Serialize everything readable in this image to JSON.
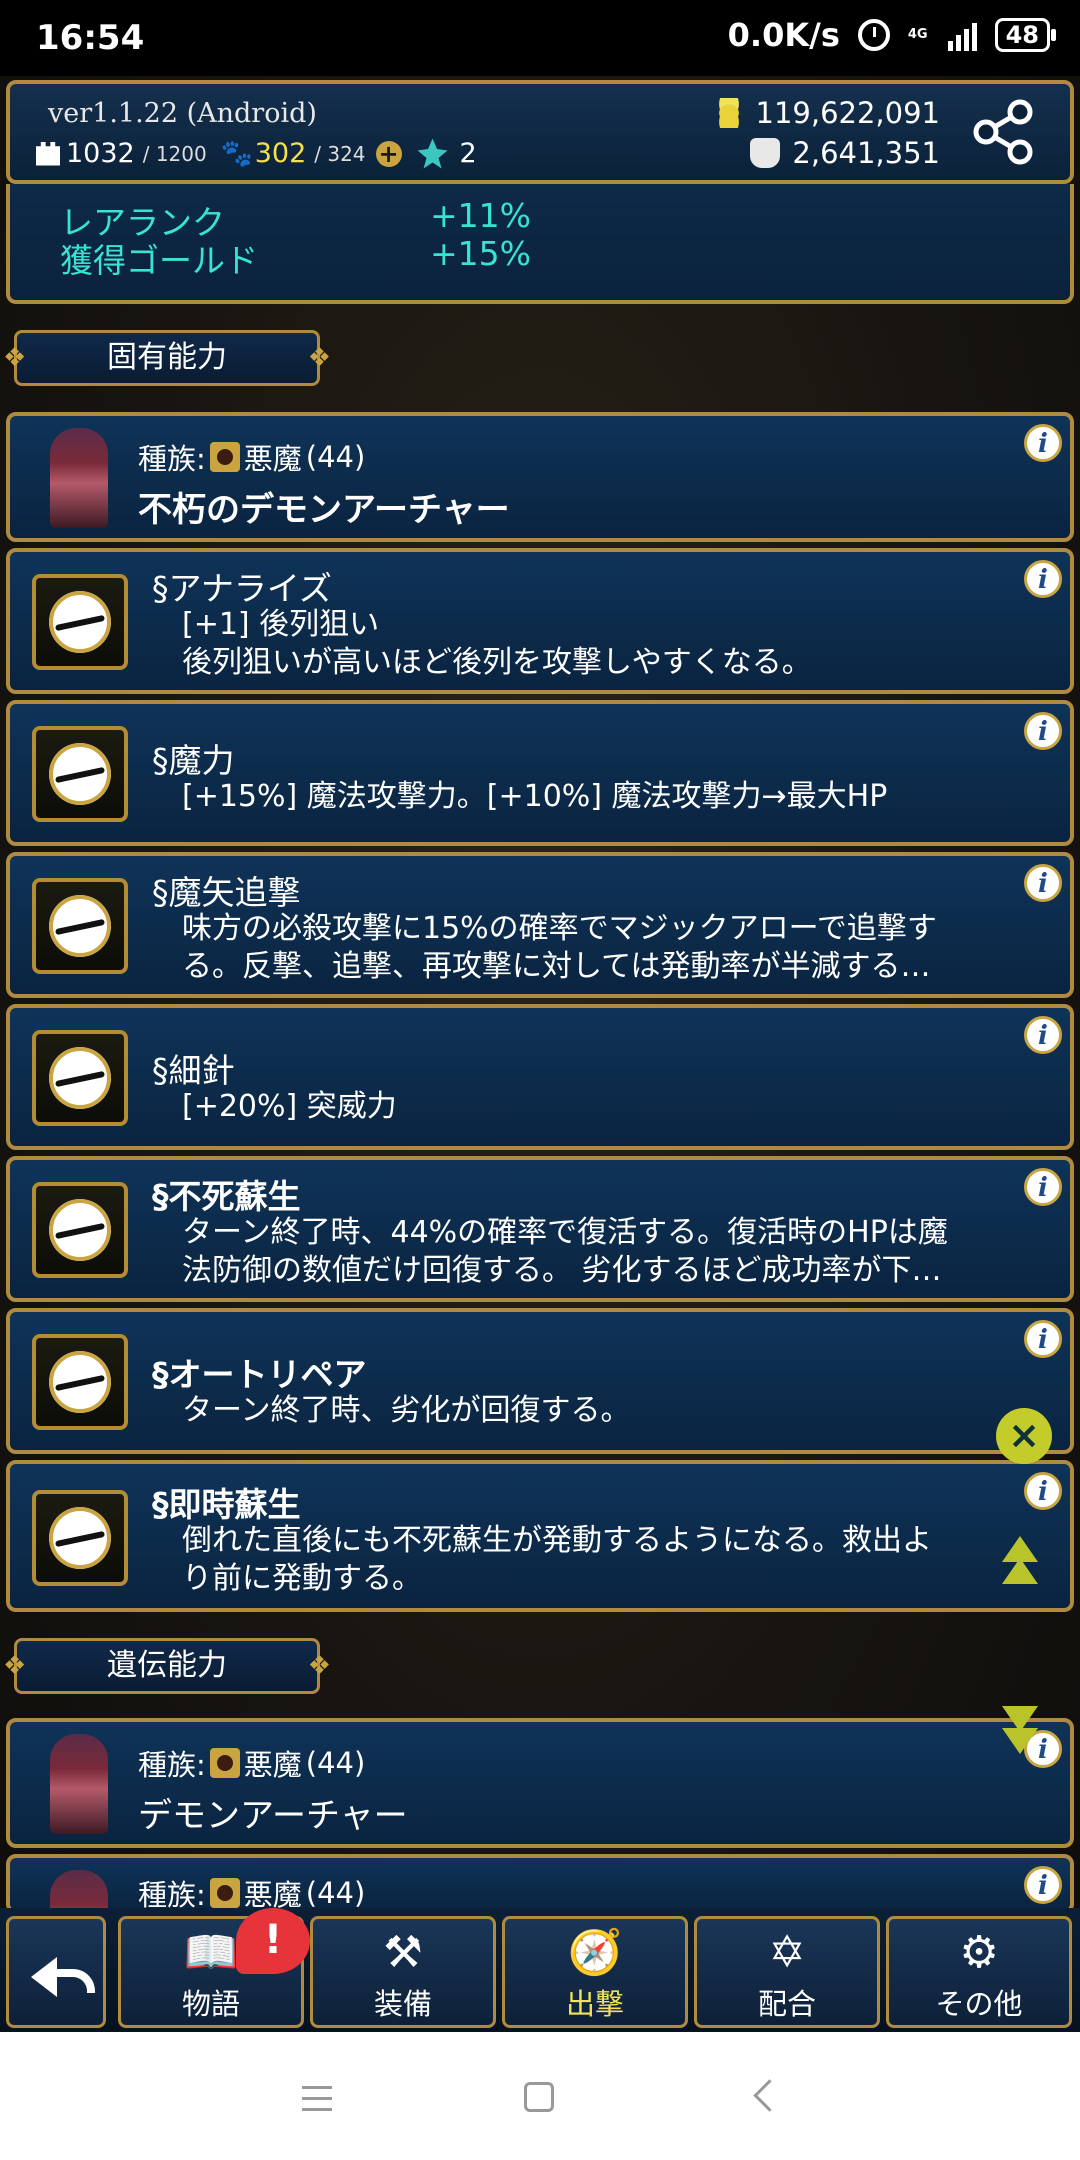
{
  "statusbar": {
    "time": "16:54",
    "network": "0.0K/s",
    "signal_type": "4G",
    "battery": "48"
  },
  "header": {
    "version": "ver1.1.22 (Android)",
    "castle_value": "1032",
    "castle_max": "/ 1200",
    "paw_value": "302",
    "paw_max": "/ 324",
    "crystal_count": "2",
    "gold": "119,622,091",
    "gems": "2,641,351"
  },
  "bonus": [
    {
      "label": "レアランク",
      "value": "+11%"
    },
    {
      "label": "獲得ゴールド",
      "value": "+15%"
    }
  ],
  "sections": {
    "innate": "固有能力",
    "inherited": "遺伝能力"
  },
  "innate_unit": {
    "race_label": "種族:",
    "race": "悪魔",
    "level": "(44)",
    "name": "不朽のデモンアーチャー"
  },
  "skills": [
    {
      "title": "§アナライズ",
      "line1": "[+1] 後列狙い",
      "line2": "後列狙いが高いほど後列を攻撃しやすくなる。"
    },
    {
      "title": "§魔力",
      "line1": "[+15%] 魔法攻撃力。[+10%] 魔法攻撃力→最大HP",
      "line2": ""
    },
    {
      "title": "§魔矢追撃",
      "line1": "味方の必殺攻撃に15%の確率でマジックアローで追撃す",
      "line2": "る。反撃、追撃、再攻撃に対しては発動率が半減する…"
    },
    {
      "title": "§細針",
      "line1": "[+20%] 突威力",
      "line2": ""
    },
    {
      "title": "§不死蘇生",
      "line1": "ターン終了時、44%の確率で復活する。復活時のHPは魔",
      "line2": "法防御の数値だけ回復する。 劣化するほど成功率が下…"
    },
    {
      "title": "§オートリペア",
      "line1": "ターン終了時、劣化が回復する。",
      "line2": ""
    },
    {
      "title": "§即時蘇生",
      "line1": "倒れた直後にも不死蘇生が発動するようになる。救出よ",
      "line2": "り前に発動する。"
    }
  ],
  "inherited_unit": {
    "race_label": "種族:",
    "race": "悪魔",
    "level": "(44)",
    "name": "デモンアーチャー"
  },
  "inherited_unit2": {
    "race_label": "種族:",
    "race": "悪魔",
    "level": "(44)"
  },
  "info_glyph": "i",
  "nav": {
    "story": "物語",
    "equip": "装備",
    "sortie": "出撃",
    "fusion": "配合",
    "other": "その他",
    "badge": "!"
  },
  "colors": {
    "accent_gold": "#b08a3e",
    "bonus_text": "#39e3d2",
    "active_nav": "#f1e35a",
    "badge": "#e7343b"
  }
}
